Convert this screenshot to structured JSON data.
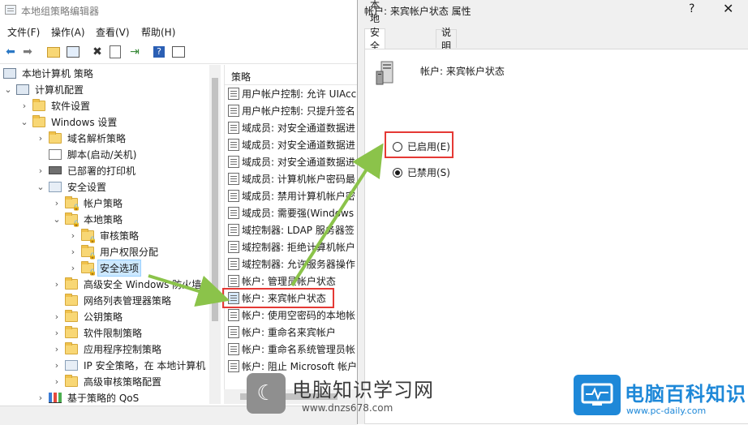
{
  "main_window": {
    "title": "本地组策略编辑器",
    "menu": [
      "文件(F)",
      "操作(A)",
      "查看(V)",
      "帮助(H)"
    ],
    "toolbar_icons": [
      "back-arrow-icon",
      "forward-arrow-icon",
      "up-folder-icon",
      "show-hide-tree-icon",
      "delete-icon",
      "properties-icon",
      "export-icon",
      "help-icon",
      "view-icon"
    ]
  },
  "tree": {
    "items": [
      {
        "label": "本地计算机 策略"
      },
      {
        "label": "计算机配置"
      },
      {
        "label": "软件设置"
      },
      {
        "label": "Windows 设置"
      },
      {
        "label": "域名解析策略"
      },
      {
        "label": "脚本(启动/关机)"
      },
      {
        "label": "已部署的打印机"
      },
      {
        "label": "安全设置"
      },
      {
        "label": "帐户策略"
      },
      {
        "label": "本地策略"
      },
      {
        "label": "审核策略"
      },
      {
        "label": "用户权限分配"
      },
      {
        "label": "安全选项"
      },
      {
        "label": "高级安全 Windows 防火墙"
      },
      {
        "label": "网络列表管理器策略"
      },
      {
        "label": "公钥策略"
      },
      {
        "label": "软件限制策略"
      },
      {
        "label": "应用程序控制策略"
      },
      {
        "label": "IP 安全策略，在 本地计算机"
      },
      {
        "label": "高级审核策略配置"
      },
      {
        "label": "基于策略的 QoS"
      }
    ]
  },
  "policy_list": {
    "header": "策略",
    "items": [
      "用户帐户控制: 允许 UIAccess",
      "用户帐户控制: 只提升签名",
      "域成员: 对安全通道数据进",
      "域成员: 对安全通道数据进",
      "域成员: 对安全通道数据进",
      "域成员: 计算机帐户密码最",
      "域成员: 禁用计算机帐户密",
      "域成员: 需要强(Windows",
      "域控制器: LDAP 服务器签",
      "域控制器: 拒绝计算机帐户",
      "域控制器: 允许服务器操作",
      "帐户: 管理员帐户状态",
      "帐户: 来宾帐户状态",
      "帐户: 使用空密码的本地帐",
      "帐户: 重命名来宾帐户",
      "帐户: 重命名系统管理员帐",
      "帐户: 阻止 Microsoft 帐户"
    ]
  },
  "dialog": {
    "title": "帐户: 来宾帐户状态 属性",
    "help": "?",
    "close": "✕",
    "tabs": [
      "本地安全设置",
      "说明"
    ],
    "policy_name": "帐户: 来宾帐户状态",
    "options": [
      {
        "label": "已启用(E)",
        "selected": false
      },
      {
        "label": "已禁用(S)",
        "selected": true
      }
    ]
  },
  "watermarks": {
    "left_name": "电脑知识学习网",
    "left_url": "www.dnzs678.com",
    "right_name": "电脑百科知识",
    "right_url": "www.pc-daily.com"
  },
  "colors": {
    "accent": "#1e88d8",
    "annotation_red": "#e53935",
    "arrow_green": "#8bc34a",
    "selection": "#cce8ff"
  }
}
